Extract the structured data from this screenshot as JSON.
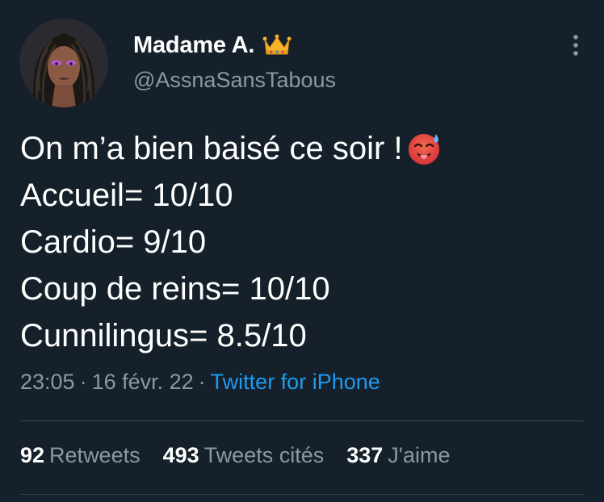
{
  "author": {
    "display_name": "Madame A.",
    "handle": "@AssnaSansTabous",
    "badge_icon": "crown-emoji"
  },
  "tweet": {
    "lines": [
      "On m’a bien baisé ce soir !",
      "Accueil= 10/10",
      "Cardio= 9/10",
      "Coup de reins= 10/10",
      "Cunnilingus= 8.5/10"
    ],
    "line1_emoji": "hot-face-emoji"
  },
  "meta": {
    "time": "23:05",
    "date": "16 févr. 22",
    "separator": "·",
    "source": "Twitter for iPhone"
  },
  "stats": {
    "retweets_count": "92",
    "retweets_label": "Retweets",
    "quotes_count": "493",
    "quotes_label": "Tweets cités",
    "likes_count": "337",
    "likes_label": "J'aime"
  },
  "colors": {
    "background": "#15202b",
    "primary_text": "#ffffff",
    "secondary_text": "#8899a6",
    "link": "#1d9bf0",
    "divider": "#38444d"
  }
}
